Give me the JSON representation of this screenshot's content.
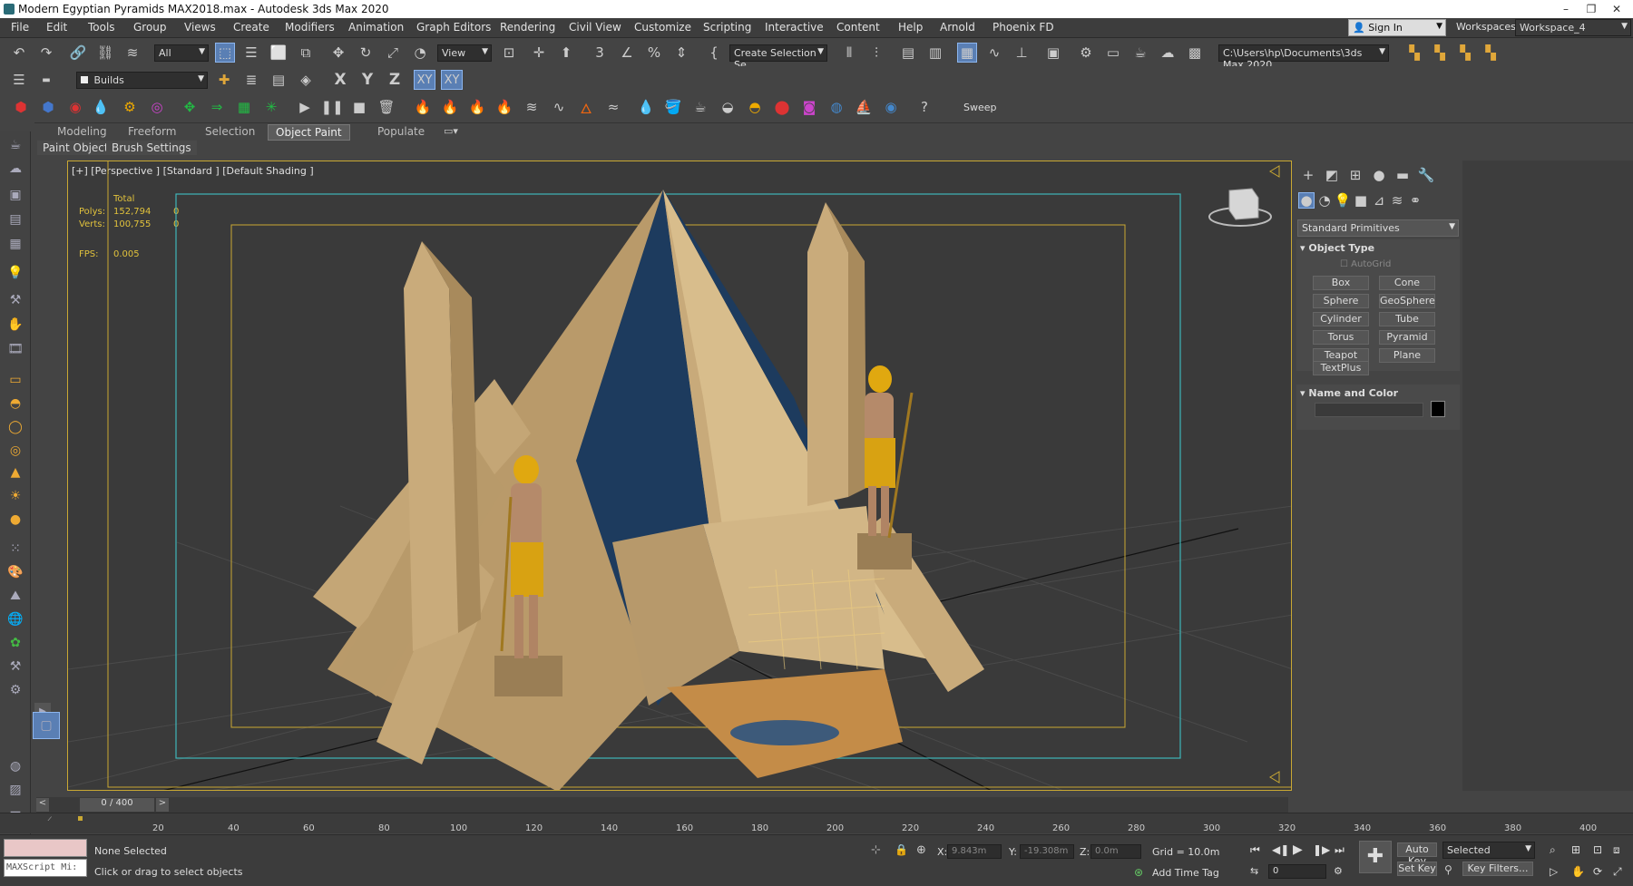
{
  "window": {
    "title": "Modern Egyptian Pyramids MAX2018.max - Autodesk 3ds Max 2020"
  },
  "menubar": [
    "File",
    "Edit",
    "Tools",
    "Group",
    "Views",
    "Create",
    "Modifiers",
    "Animation",
    "Graph Editors",
    "Rendering",
    "Civil View",
    "Customize",
    "Scripting",
    "Interactive",
    "Content",
    "Help",
    "Arnold",
    "Phoenix FD"
  ],
  "account": {
    "sign_in": "Sign In",
    "workspaces_label": "Workspaces:",
    "workspace_value": "Workspace_4"
  },
  "main_toolbar": {
    "selection_filter": "All",
    "ref_coord": "View",
    "create_selection_set": "Create Selection Se",
    "project_path": "C:\\Users\\hp\\Documents\\3ds Max 2020"
  },
  "axis_toolbar": {
    "layer_dropdown": "Builds",
    "x": "X",
    "y": "Y",
    "z": "Z",
    "xy": "XY",
    "xy2": "XY"
  },
  "third_toolbar": {
    "sweep": "Sweep"
  },
  "ribbon": {
    "tabs": [
      "Modeling",
      "Freeform",
      "Selection",
      "Object Paint",
      "Populate"
    ],
    "active_tab": "Object Paint",
    "subtabs": [
      "Paint Objects",
      "Brush Settings"
    ]
  },
  "viewport": {
    "label": "[+] [Perspective ] [Standard ] [Default Shading ]",
    "stats": {
      "total_header": "Total",
      "polys_label": "Polys:",
      "polys_total": "152,794",
      "polys_sel": "0",
      "verts_label": "Verts:",
      "verts_total": "100,755",
      "verts_sel": "0",
      "fps_label": "FPS:",
      "fps_value": "0.005"
    }
  },
  "command_panel": {
    "category_dropdown": "Standard Primitives",
    "object_type_header": "Object Type",
    "autogrid": "AutoGrid",
    "buttons": [
      "Box",
      "Cone",
      "Sphere",
      "GeoSphere",
      "Cylinder",
      "Tube",
      "Torus",
      "Pyramid",
      "Teapot",
      "Plane",
      "TextPlus"
    ],
    "name_color_header": "Name and Color",
    "object_color": "#000000"
  },
  "timeline": {
    "frame_display": "0 / 400",
    "prev": "<",
    "next": ">",
    "ticks": [
      "20",
      "40",
      "60",
      "80",
      "100",
      "120",
      "140",
      "160",
      "180",
      "200",
      "220",
      "240",
      "260",
      "280",
      "300",
      "320",
      "340",
      "360",
      "380",
      "400"
    ]
  },
  "statusbar": {
    "maxscript": "MAXScript Mi:",
    "selection_status": "None Selected",
    "prompt": "Click or drag to select objects",
    "x_label": "X:",
    "x_value": "9.843m",
    "y_label": "Y:",
    "y_value": "-19.308m",
    "z_label": "Z:",
    "z_value": "0.0m",
    "grid": "Grid = 10.0m",
    "add_time_tag": "Add Time Tag",
    "auto_key": "Auto Key",
    "set_key": "Set Key",
    "selected_dropdown": "Selected",
    "key_filters": "Key Filters...",
    "frame_field": "0"
  },
  "colors": {
    "accent_blue": "#5a7fb4",
    "viewport_border": "#c9a833",
    "stats_text": "#e1c23c",
    "safe_frame": "#3fb6b8"
  }
}
